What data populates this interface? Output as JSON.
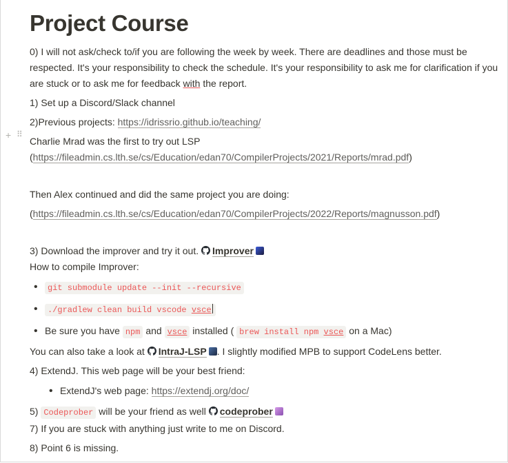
{
  "title": "Project Course",
  "p0": "0) I will not ask/check to/if you are following the week by week. There are deadlines and those must be respected. It's your responsibility to check the schedule. It's your responsibility to ask me for clarification if you are stuck or to ask me for feedback ",
  "p0_with": "with",
  "p0_end": " the report.",
  "p1": "1) Set up a Discord/Slack channel",
  "p2_prefix": "2)Previous projects: ",
  "p2_link": "https://idrissrio.github.io/teaching/",
  "charlie_text": "Charlie Mrad was the first to try out LSP",
  "charlie_open": "(",
  "charlie_link": "https://fileadmin.cs.lth.se/cs/Education/edan70/CompilerProjects/2021/Reports/mrad.pdf",
  "charlie_close": ")",
  "alex_text": "Then Alex continued and did the same project you are doing:",
  "alex_open": "(",
  "alex_link": "https://fileadmin.cs.lth.se/cs/Education/edan70/CompilerProjects/2022/Reports/magnusson.pdf",
  "alex_close": ")",
  "p3_prefix": "3) Download the improver and try it out. ",
  "p3_link": "Improver",
  "compile_heading": "How to compile Improver:",
  "bullet1_code": "git submodule update --init --recursive",
  "bullet2_code_a": "./gradlew clean build vscode ",
  "bullet2_code_b": "vsce",
  "bullet3": {
    "a": "Be sure you have ",
    "npm": "npm",
    "and": " and ",
    "vsce": "vsce",
    "installed": " installed ( ",
    "brew_a": "brew install npm ",
    "brew_b": "vsce",
    "mac": " on a Mac)"
  },
  "intraj_prefix": "You can also take a look at ",
  "intraj_link": "IntraJ-LSP",
  "intraj_suffix": ". I slightly modified MPB to support CodeLens better.",
  "p4": "4) ExtendJ. This web page will be your best friend:",
  "extendj_label": "ExtendJ's web page: ",
  "extendj_link": "https://extendj.org/doc/",
  "p5_prefix": "5) ",
  "p5_code": "Codeprober",
  "p5_mid": " will be your friend as well ",
  "p5_link": "codeprober",
  "p7": "7) If you are stuck with anything just write to me on Discord.",
  "p8": "8) Point 6 is missing.",
  "block_handle": "+",
  "block_grip": "⠿",
  "colors": {
    "text": "#37352f",
    "code_red": "#eb5757",
    "code_bg": "#f2f1ee",
    "link": "#5f5e5b"
  }
}
